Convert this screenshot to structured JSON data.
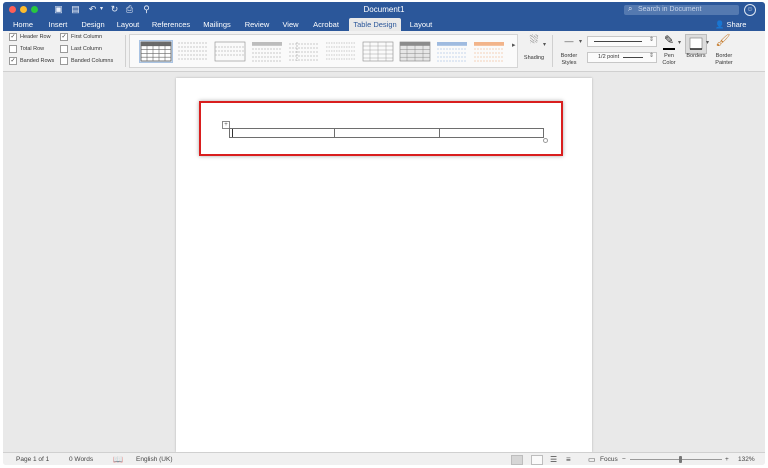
{
  "window": {
    "title": "Document1",
    "search_placeholder": "Search in Document"
  },
  "tabs": [
    {
      "label": "Home"
    },
    {
      "label": "Insert"
    },
    {
      "label": "Design"
    },
    {
      "label": "Layout"
    },
    {
      "label": "References"
    },
    {
      "label": "Mailings"
    },
    {
      "label": "Review"
    },
    {
      "label": "View"
    },
    {
      "label": "Acrobat"
    },
    {
      "label": "Table Design",
      "active": true
    },
    {
      "label": "Layout"
    }
  ],
  "share_label": "Share",
  "table_style_options": [
    {
      "label": "Header Row",
      "checked": true
    },
    {
      "label": "Total Row",
      "checked": false
    },
    {
      "label": "Banded Rows",
      "checked": true
    },
    {
      "label": "First Column",
      "checked": true
    },
    {
      "label": "Last Column",
      "checked": false
    },
    {
      "label": "Banded Columns",
      "checked": false
    }
  ],
  "ribbon": {
    "shading_label": "Shading",
    "border_styles_label": "Border Styles",
    "border_weight": "1/2 point",
    "pen_color_label": "Pen Color",
    "borders_label": "Borders",
    "border_painter_label": "Border Painter"
  },
  "status": {
    "page": "Page 1 of 1",
    "words": "0 Words",
    "language": "English (UK)",
    "focus": "Focus",
    "zoom": "132%"
  },
  "colors": {
    "brand": "#2b579a",
    "highlight": "#d91e1e"
  }
}
